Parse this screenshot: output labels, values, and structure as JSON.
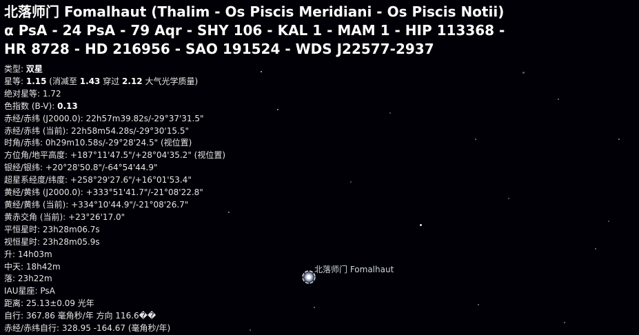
{
  "object": {
    "title_lines": [
      "北落师门 Fomalhaut (Thalim - Os Piscis Meridiani - Os Piscis Notii)",
      "α PsA - 24 PsA - 79 Aqr - SHY 106 - KAL 1 - MAM 1 - HIP 113368 -",
      "HR 8728 - HD 216956 - SAO 191524 - WDS J22577-2937"
    ],
    "label": "北落师门 Fomalhaut"
  },
  "info": {
    "type_label": "类型: ",
    "type_value": "双星",
    "magnitude_label": "星等: ",
    "magnitude_value": "1.15",
    "magnitude_mid": " (消减至 ",
    "magnitude_extinct": "1.43",
    "magnitude_mid2": " 穿过 ",
    "magnitude_airmass": "2.12",
    "magnitude_tail": " 大气光学质量)",
    "abs_magnitude": "绝对星等: 1.72",
    "color_index_label": "色指数 (B-V): ",
    "color_index_value": "0.13",
    "ra_dec_j2000": "赤经/赤纬 (J2000.0): 22h57m39.82s/-29°37'31.5\"",
    "ra_dec_current": "赤经/赤纬 (当前): 22h58m54.28s/-29°30'15.5\"",
    "hour_angle": "时角/赤纬: 0h29m10.58s/-29°28'24.5\" (视位置)",
    "az_alt": "方位角/地平高度: +187°11'47.5\"/+28°04'35.2\" (视位置)",
    "galactic": "银经/银纬: +20°28'50.8\"/-64°54'44.9\"",
    "supergalactic": "超星系经度/纬度: +258°29'27.6\"/+16°01'53.4\"",
    "ecliptic_j2000": "黄经/黄纬 (J2000.0): +333°51'41.7\"/-21°08'22.8\"",
    "ecliptic_current": "黄经/黄纬 (当前): +334°10'44.9\"/-21°08'26.7\"",
    "obliquity": "黄赤交角 (当前): +23°26'17.0\"",
    "mean_sidereal": "平恒星时: 23h28m06.7s",
    "apparent_sidereal": "视恒星时: 23h28m05.9s",
    "rise": "升: 14h03m",
    "transit": "中天: 18h42m",
    "set": "落: 23h22m",
    "iau_constellation": "IAU星座: PsA",
    "distance": "距离: 25.13±0.09 光年",
    "proper_motion": "自行: 367.86 毫角秒/年 方向 116.6��",
    "pm_ra_dec": "赤经/赤纬自行: 328.95 -164.67 (毫角秒/年)"
  },
  "colors": {
    "background": "#000006",
    "text": "#e6e6e6",
    "label": "#cfd3e0"
  }
}
